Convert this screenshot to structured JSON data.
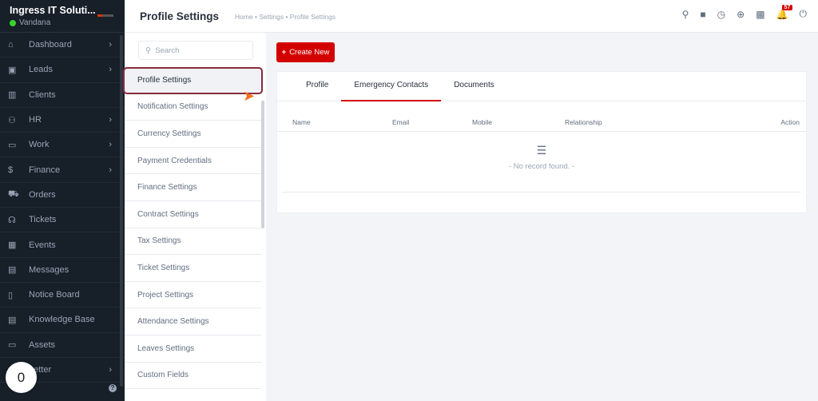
{
  "brand": {
    "company": "Ingress IT Soluti...",
    "user": "Vandana",
    "status_color": "#39d12f"
  },
  "sidebar": {
    "items": [
      {
        "label": "Dashboard",
        "icon": "home-icon",
        "chevron": true
      },
      {
        "label": "Leads",
        "icon": "id-card-icon",
        "chevron": true
      },
      {
        "label": "Clients",
        "icon": "building-icon",
        "chevron": false
      },
      {
        "label": "HR",
        "icon": "users-icon",
        "chevron": true
      },
      {
        "label": "Work",
        "icon": "briefcase-icon",
        "chevron": true
      },
      {
        "label": "Finance",
        "icon": "dollar-icon",
        "chevron": true
      },
      {
        "label": "Orders",
        "icon": "cart-icon",
        "chevron": false
      },
      {
        "label": "Tickets",
        "icon": "headset-icon",
        "chevron": false
      },
      {
        "label": "Events",
        "icon": "calendar-icon",
        "chevron": false
      },
      {
        "label": "Messages",
        "icon": "chat-icon",
        "chevron": false
      },
      {
        "label": "Notice Board",
        "icon": "clipboard-icon",
        "chevron": false
      },
      {
        "label": "Knowledge Base",
        "icon": "book-icon",
        "chevron": false
      },
      {
        "label": "Assets",
        "icon": "monitor-icon",
        "chevron": false
      },
      {
        "label": "Letter",
        "icon": "letter-icon",
        "chevron": true
      }
    ],
    "counter": "0",
    "help_icon": "question-icon"
  },
  "header": {
    "title": "Profile Settings",
    "breadcrumb": "Home • Settings • Profile Settings",
    "notification_count": "57"
  },
  "settings_menu": {
    "search_placeholder": "Search",
    "items": [
      "Profile Settings",
      "Notification Settings",
      "Currency Settings",
      "Payment Credentials",
      "Finance Settings",
      "Contract Settings",
      "Tax Settings",
      "Ticket Settings",
      "Project Settings",
      "Attendance Settings",
      "Leaves Settings",
      "Custom Fields"
    ],
    "active": "Profile Settings"
  },
  "main": {
    "create_label": "Create New",
    "tabs": [
      "Profile",
      "Emergency Contacts",
      "Documents"
    ],
    "active_tab": "Emergency Contacts",
    "columns": [
      "Name",
      "Email",
      "Mobile",
      "Relationship",
      "Action"
    ],
    "empty_message": "- No record found. -"
  },
  "colors": {
    "accent": "#d30000",
    "sidebar_bg": "#171f29",
    "highlight_border": "#8b2a3b"
  }
}
